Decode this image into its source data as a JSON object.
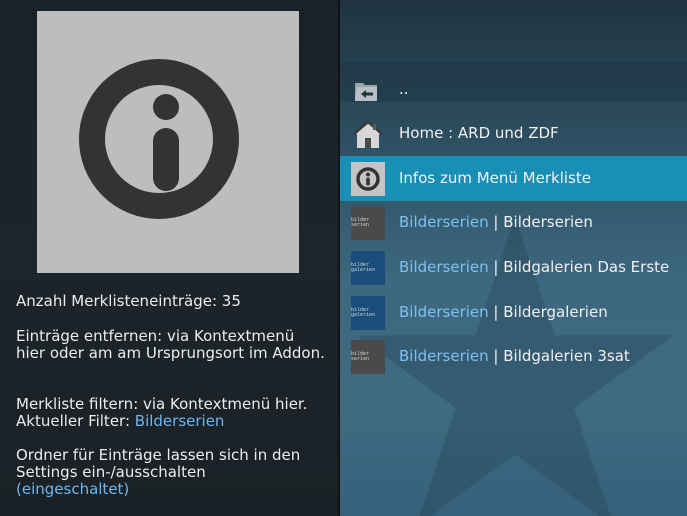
{
  "info_panel": {
    "count_text": "Anzahl Merklisteneinträge: 35",
    "remove_text": "Einträge entfernen: via Kontextmenü hier oder am am Ursprungsort im Addon.",
    "filter_line1": "Merkliste filtern: via Kontextmenü hier.",
    "filter_prefix": "Aktueller Filter: ",
    "filter_value": "Bilderserien",
    "folder_text": "Ordner für Einträge lassen sich in den Settings ein-/ausschalten",
    "folder_state": "(eingeschaltet)"
  },
  "list": {
    "items": [
      {
        "icon": "back-folder-icon",
        "label": ".."
      },
      {
        "icon": "home-icon",
        "label": "Home : ARD und ZDF"
      },
      {
        "icon": "info-icon",
        "label": "Infos zum Menü Merkliste",
        "selected": true
      },
      {
        "icon": "thumbnail-icon",
        "category": "Bilderserien",
        "separator": " | ",
        "label": "Bilderserien",
        "thumb_color": "#4a4a4a",
        "thumb_text": "bilder serien"
      },
      {
        "icon": "thumbnail-icon",
        "category": "Bilderserien",
        "separator": " | ",
        "label": "Bildgalerien Das Erste",
        "thumb_color": "#1b4d7a",
        "thumb_text": "bilder galerien"
      },
      {
        "icon": "thumbnail-icon",
        "category": "Bilderserien",
        "separator": " | ",
        "label": "Bildergalerien",
        "thumb_color": "#1b4d7a",
        "thumb_text": "bilder galerien"
      },
      {
        "icon": "thumbnail-icon",
        "category": "Bilderserien",
        "separator": " | ",
        "label": "Bildgalerien 3sat",
        "thumb_color": "#4a4a4a",
        "thumb_text": "bilder serien"
      }
    ]
  },
  "colors": {
    "accent": "#6cb6f0",
    "selection": "#1a8fb5",
    "thumb_bg": "#bdbdbd",
    "info_icon": "#333333"
  }
}
